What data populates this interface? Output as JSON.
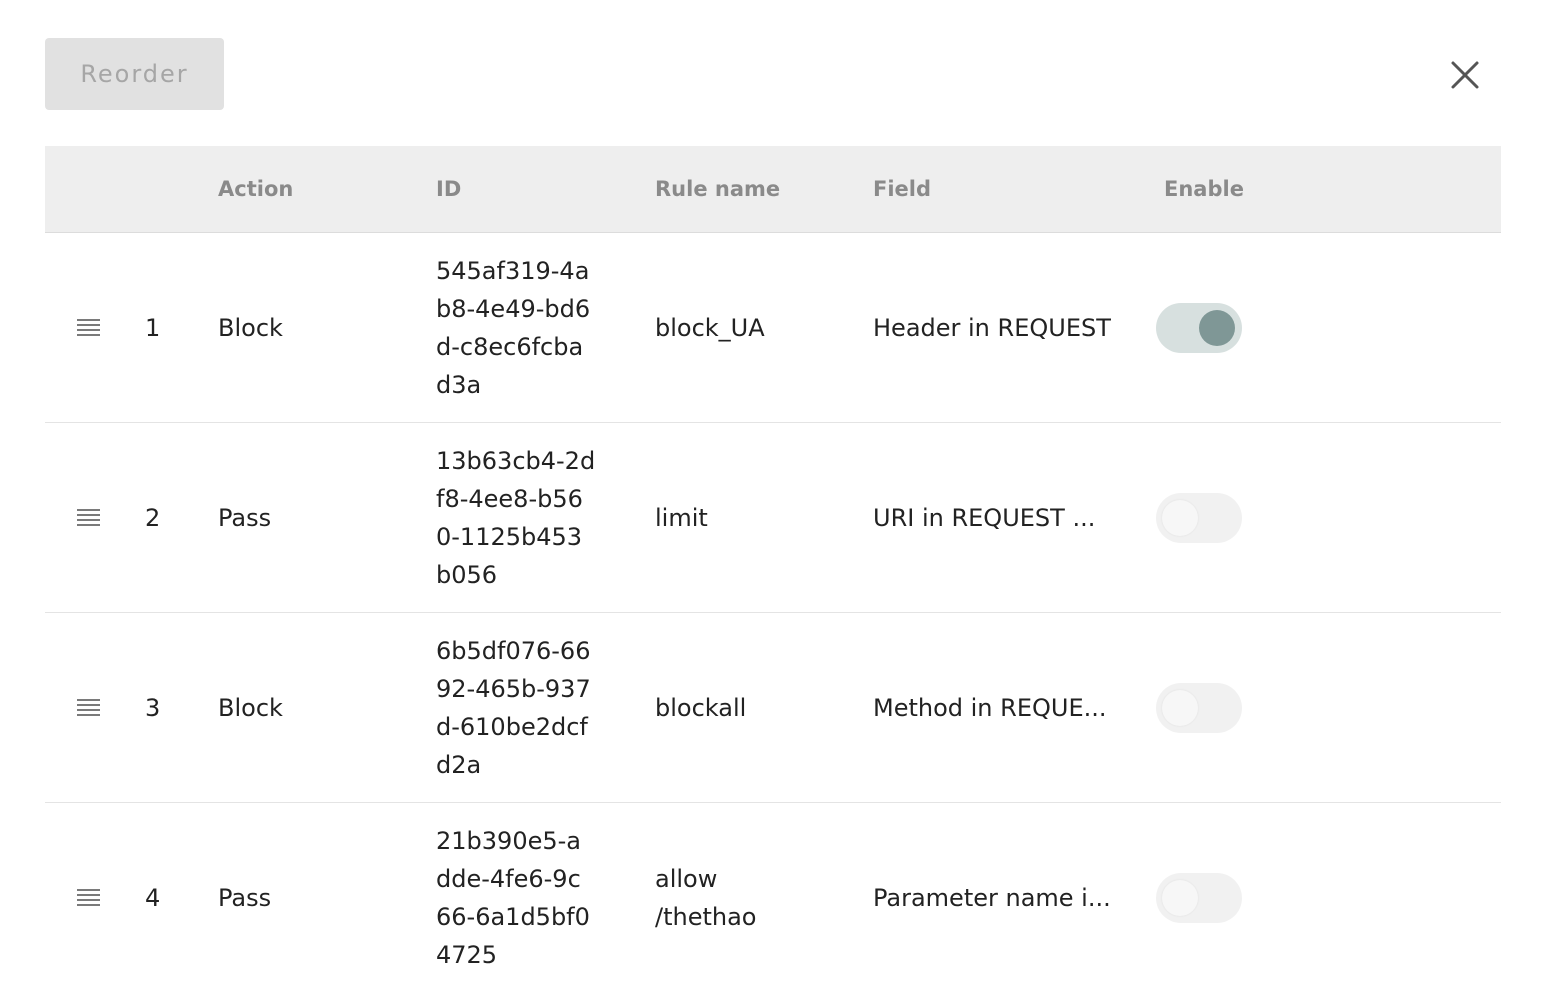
{
  "toolbar": {
    "reorder_label": "Reorder"
  },
  "columns": {
    "action": "Action",
    "id": "ID",
    "rule_name": "Rule name",
    "field": "Field",
    "enable": "Enable"
  },
  "rows": [
    {
      "num": "1",
      "action": "Block",
      "id": "545af319-4ab8-4e49-bd6d-c8ec6fcbad3a",
      "rule_name": "block_UA",
      "field": "Header in REQUEST",
      "enabled": true
    },
    {
      "num": "2",
      "action": "Pass",
      "id": "13b63cb4-2df8-4ee8-b560-1125b453b056",
      "rule_name": "limit",
      "field": "URI in REQUEST ...",
      "enabled": false
    },
    {
      "num": "3",
      "action": "Block",
      "id": "6b5df076-6692-465b-937d-610be2dcfd2a",
      "rule_name": "blockall",
      "field": "Method in REQUE...",
      "enabled": false
    },
    {
      "num": "4",
      "action": "Pass",
      "id": "21b390e5-adde-4fe6-9c66-6a1d5bf04725",
      "rule_name": "allow /thethao",
      "field": "Parameter name i...",
      "enabled": false
    }
  ],
  "icons": {
    "close": "close-icon",
    "drag": "drag-handle-icon"
  },
  "colors": {
    "toggle_on_track": "#d7e0df",
    "toggle_on_knob": "#7f9796",
    "toggle_off_track": "#f1f1f1",
    "header_bg": "#eeeeee"
  }
}
